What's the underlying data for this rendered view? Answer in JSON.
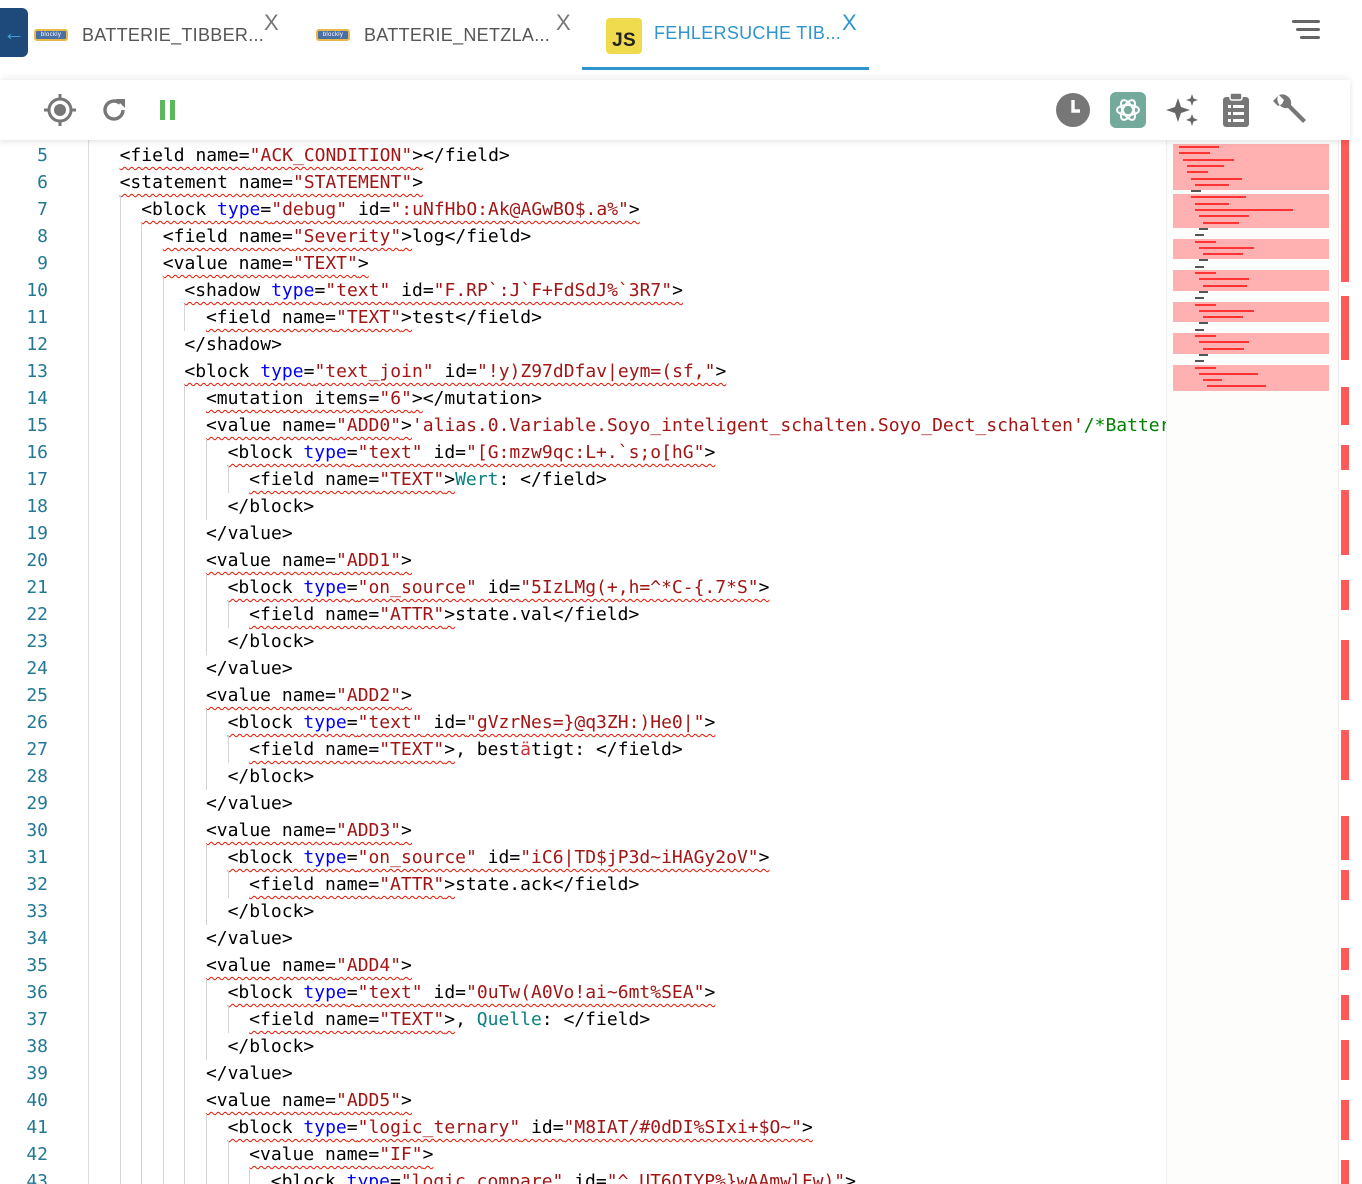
{
  "tabs": [
    {
      "label": "BATTERIE_TIBBER...",
      "icon": "blockly-icon",
      "active": false
    },
    {
      "label": "BATTERIE_NETZLA...",
      "icon": "blockly-icon",
      "active": false
    },
    {
      "label": "FEHLERSUCHE TIB...",
      "icon": "js-icon",
      "active": true
    }
  ],
  "blockly_icon_text": "blockly",
  "js_icon_text": "JS",
  "close_glyph": "X",
  "back_glyph": "←",
  "toolbar": {
    "left": [
      "target-icon",
      "reload-icon",
      "pause-icon"
    ],
    "right": [
      "history-icon",
      "chatgpt-icon",
      "ai-sparkle-icon",
      "clipboard-icon",
      "wrench-icon"
    ]
  },
  "colors": {
    "accent": "#2e95cf",
    "pause": "#5cb85c",
    "chatgpt": "#74aa9c",
    "error": "#e51400"
  },
  "lines": [
    {
      "n": "5",
      "i": 1,
      "e": true,
      "code": "<field name=\"ACK_CONDITION\"></field>"
    },
    {
      "n": "6",
      "i": 1,
      "e": true,
      "code": "<statement name=\"STATEMENT\">"
    },
    {
      "n": "7",
      "i": 2,
      "e": true,
      "code": "<block type=\"debug\" id=\":uNfHbO:Ak@AGwBO$.a%\">"
    },
    {
      "n": "8",
      "i": 3,
      "e": true,
      "code": "<field name=\"Severity\">log</field>"
    },
    {
      "n": "9",
      "i": 3,
      "e": true,
      "code": "<value name=\"TEXT\">"
    },
    {
      "n": "10",
      "i": 4,
      "e": true,
      "code": "<shadow type=\"text\" id=\"F.RP`:J`F+FdSdJ%`3R7\">"
    },
    {
      "n": "11",
      "i": 5,
      "e": true,
      "code": "<field name=\"TEXT\">test</field>"
    },
    {
      "n": "12",
      "i": 4,
      "e": false,
      "code": "</shadow>"
    },
    {
      "n": "13",
      "i": 4,
      "e": true,
      "code": "<block type=\"text_join\" id=\"!y)Z97dDfav|eym=(sf,\">"
    },
    {
      "n": "14",
      "i": 5,
      "e": true,
      "code": "<mutation items=\"6\"></mutation>"
    },
    {
      "n": "15",
      "i": 5,
      "e": true,
      "code": "<value name=\"ADD0\">'alias.0.Variable.Soyo_inteligent_schalten.Soyo_Dect_schalten'/*Batter",
      "hl": [
        [
          "'alias.0.Variable.Soyo_inteligent_schalten.Soyo_Dect_schalten'",
          "s"
        ],
        [
          "/*Batter",
          "gr"
        ]
      ]
    },
    {
      "n": "16",
      "i": 6,
      "e": true,
      "code": "<block type=\"text\" id=\"[G:mzw9qc:L+.`s;o[hG\">"
    },
    {
      "n": "17",
      "i": 7,
      "e": true,
      "code": "<field name=\"TEXT\">Wert: </field>",
      "hl": [
        [
          "Wert",
          "c"
        ]
      ]
    },
    {
      "n": "18",
      "i": 6,
      "e": false,
      "code": "</block>"
    },
    {
      "n": "19",
      "i": 5,
      "e": false,
      "code": "</value>"
    },
    {
      "n": "20",
      "i": 5,
      "e": true,
      "code": "<value name=\"ADD1\">"
    },
    {
      "n": "21",
      "i": 6,
      "e": true,
      "code": "<block type=\"on_source\" id=\"5IzLMg(+,h=^*C-{.7*S\">"
    },
    {
      "n": "22",
      "i": 7,
      "e": true,
      "code": "<field name=\"ATTR\">state.val</field>"
    },
    {
      "n": "23",
      "i": 6,
      "e": false,
      "code": "</block>"
    },
    {
      "n": "24",
      "i": 5,
      "e": false,
      "code": "</value>"
    },
    {
      "n": "25",
      "i": 5,
      "e": true,
      "code": "<value name=\"ADD2\">"
    },
    {
      "n": "26",
      "i": 6,
      "e": true,
      "code": "<block type=\"text\" id=\"gVzrNes=}@q3ZH:)He0|\">"
    },
    {
      "n": "27",
      "i": 7,
      "e": true,
      "code": "<field name=\"TEXT\">, bestätigt: </field>",
      "hl": [
        [
          "ä",
          "d"
        ]
      ]
    },
    {
      "n": "28",
      "i": 6,
      "e": false,
      "code": "</block>"
    },
    {
      "n": "29",
      "i": 5,
      "e": false,
      "code": "</value>"
    },
    {
      "n": "30",
      "i": 5,
      "e": true,
      "code": "<value name=\"ADD3\">"
    },
    {
      "n": "31",
      "i": 6,
      "e": true,
      "code": "<block type=\"on_source\" id=\"iC6|TD$jP3d~iHAGy2oV\">"
    },
    {
      "n": "32",
      "i": 7,
      "e": true,
      "code": "<field name=\"ATTR\">state.ack</field>"
    },
    {
      "n": "33",
      "i": 6,
      "e": false,
      "code": "</block>"
    },
    {
      "n": "34",
      "i": 5,
      "e": false,
      "code": "</value>"
    },
    {
      "n": "35",
      "i": 5,
      "e": true,
      "code": "<value name=\"ADD4\">"
    },
    {
      "n": "36",
      "i": 6,
      "e": true,
      "code": "<block type=\"text\" id=\"0uTw(A0Vo!ai~6mt%SEA\">"
    },
    {
      "n": "37",
      "i": 7,
      "e": true,
      "code": "<field name=\"TEXT\">, Quelle: </field>",
      "hl": [
        [
          "Quelle",
          "c"
        ]
      ]
    },
    {
      "n": "38",
      "i": 6,
      "e": false,
      "code": "</block>"
    },
    {
      "n": "39",
      "i": 5,
      "e": false,
      "code": "</value>"
    },
    {
      "n": "40",
      "i": 5,
      "e": true,
      "code": "<value name=\"ADD5\">"
    },
    {
      "n": "41",
      "i": 6,
      "e": true,
      "code": "<block type=\"logic_ternary\" id=\"M8IAT/#0dDI%SIxi+$O~\">"
    },
    {
      "n": "42",
      "i": 7,
      "e": true,
      "code": "<value name=\"IF\">"
    },
    {
      "n": "43",
      "i": 8,
      "e": true,
      "code": "<block type=\"logic_compare\" id=\"^_UT6QIYP%}wAAmwlFw)\">"
    }
  ]
}
